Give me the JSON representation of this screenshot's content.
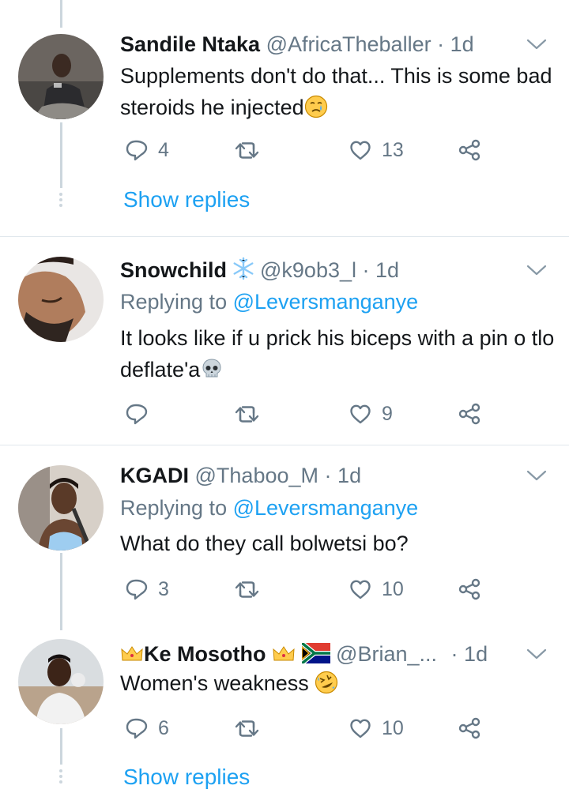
{
  "tweets": [
    {
      "name": "Sandile Ntaka",
      "handle": "@AfricaTheballer",
      "separator": "·",
      "time": "1d",
      "text": "Supplements don't do that... This is some bad steroids he injected",
      "stats": {
        "reply": "4",
        "retweet": "",
        "like": "13"
      },
      "show_replies": "Show replies"
    },
    {
      "name": "Snowchild",
      "handle": "@k9ob3_l",
      "separator": "·",
      "time": "1d",
      "replying_label": "Replying to",
      "replying_to": "@Leversmanganye",
      "text": "It looks like if u prick his biceps with a pin o tlo deflate'a",
      "stats": {
        "reply": "",
        "retweet": "",
        "like": "9"
      }
    },
    {
      "name": "KGADI",
      "handle": "@Thaboo_M",
      "separator": "·",
      "time": "1d",
      "replying_label": "Replying to",
      "replying_to": "@Leversmanganye",
      "text": "What do they call bolwetsi bo?",
      "stats": {
        "reply": "3",
        "retweet": "",
        "like": "10"
      }
    },
    {
      "name": "Ke Mosotho",
      "handle": "@Brian_...",
      "separator": "·",
      "time": "1d",
      "text": "Women's weakness",
      "stats": {
        "reply": "6",
        "retweet": "",
        "like": "10"
      },
      "show_replies": "Show replies"
    }
  ],
  "colors": {
    "accent": "#1da1f2",
    "secondary_text": "#657786",
    "primary_text": "#14171a",
    "divider": "#e1e8ed",
    "thread_line": "#ccd6dd"
  },
  "icons": [
    "reply-icon",
    "retweet-icon",
    "like-icon",
    "share-icon",
    "chevron-down-icon",
    "snowflake-icon",
    "crown-icon",
    "south-africa-flag-icon"
  ]
}
